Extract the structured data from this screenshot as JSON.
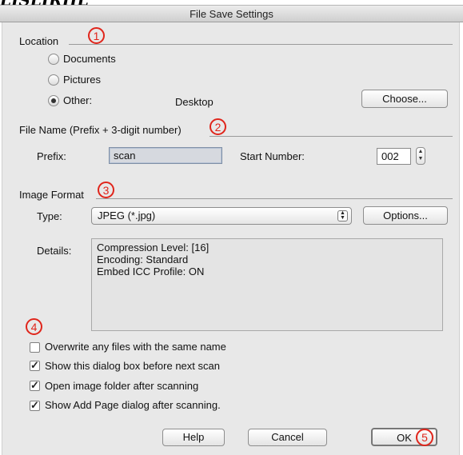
{
  "top_fragment": "𝑳𝑰𝑺𝑳𝑰𝑹𝑯𝑳",
  "window": {
    "title": "File Save Settings"
  },
  "location": {
    "label": "Location",
    "marker": "1",
    "options": [
      {
        "label": "Documents",
        "selected": false
      },
      {
        "label": "Pictures",
        "selected": false
      },
      {
        "label": "Other:",
        "selected": true
      }
    ],
    "other_value": "Desktop",
    "choose_label": "Choose..."
  },
  "file_name": {
    "label": "File Name (Prefix + 3-digit number)",
    "marker": "2",
    "prefix_label": "Prefix:",
    "prefix_value": "scan",
    "start_label": "Start Number:",
    "start_value": "002"
  },
  "image_format": {
    "label": "Image Format",
    "marker": "3",
    "type_label": "Type:",
    "type_value": "JPEG (*.jpg)",
    "options_label": "Options...",
    "details_label": "Details:",
    "details_lines": [
      "Compression Level: [16]",
      "Encoding: Standard",
      "Embed ICC Profile: ON"
    ]
  },
  "checkboxes": {
    "marker": "4",
    "items": [
      {
        "label": "Overwrite any files with the same name",
        "checked": false
      },
      {
        "label": "Show this dialog box before next scan",
        "checked": true
      },
      {
        "label": "Open image folder after scanning",
        "checked": true
      },
      {
        "label": "Show Add Page dialog after scanning.",
        "checked": true
      }
    ]
  },
  "buttons": {
    "help": "Help",
    "cancel": "Cancel",
    "ok": "OK",
    "marker": "5"
  }
}
